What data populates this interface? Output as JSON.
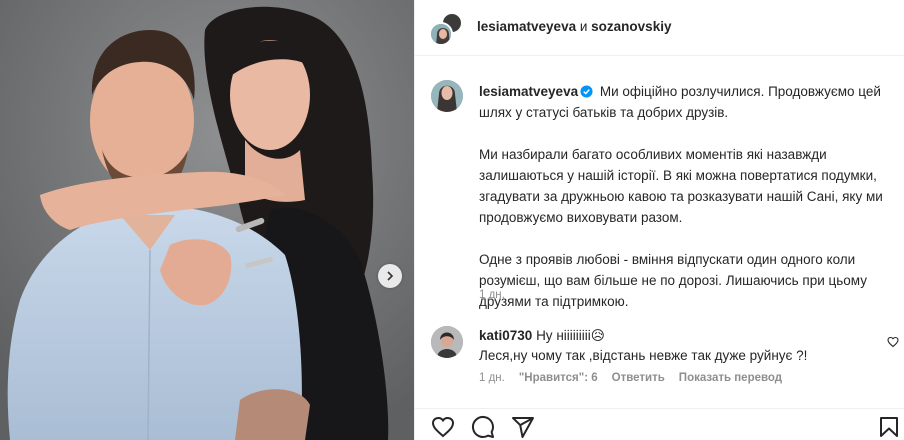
{
  "header": {
    "user1": "lesiamatveyeva",
    "conjunction": "и",
    "user2": "sozanovskiy"
  },
  "caption": {
    "username": "lesiamatveyeva",
    "paragraph1": "Ми офіційно розлучилися. Продовжуємо цей шлях у статусі батьків та добрих друзів.",
    "paragraph2": "Ми назбирали багато особливих моментів які назавжди залишаються у нашій історії. В які можна повертатися подумки, згадувати за дружньою кавою та розказувати нашій Сані, яку ми продовжуємо виховувати разом.",
    "paragraph3": "Одне з проявів любові - вміння відпускати один одного коли розумієш, що вам більше не по дорозі. Лишаючись при цьому друзями та підтримкою.",
    "time": "1 дн."
  },
  "comment": {
    "username": "kati0730",
    "line1": "Ну нііііііііі😥",
    "line2": "Леся,ну чому так ,відстань невже так дуже руйнує ?!",
    "time": "1 дн.",
    "likes": "\"Нравится\": 6",
    "reply": "Ответить",
    "translate": "Показать перевод"
  },
  "colors": {
    "text": "#262626",
    "muted": "#8e8e8e",
    "verified": "#0095f6",
    "divider": "#efefef"
  },
  "icons": [
    "heart-icon",
    "comment-icon",
    "share-icon",
    "bookmark-icon",
    "chevron-right-icon",
    "verified-icon"
  ]
}
